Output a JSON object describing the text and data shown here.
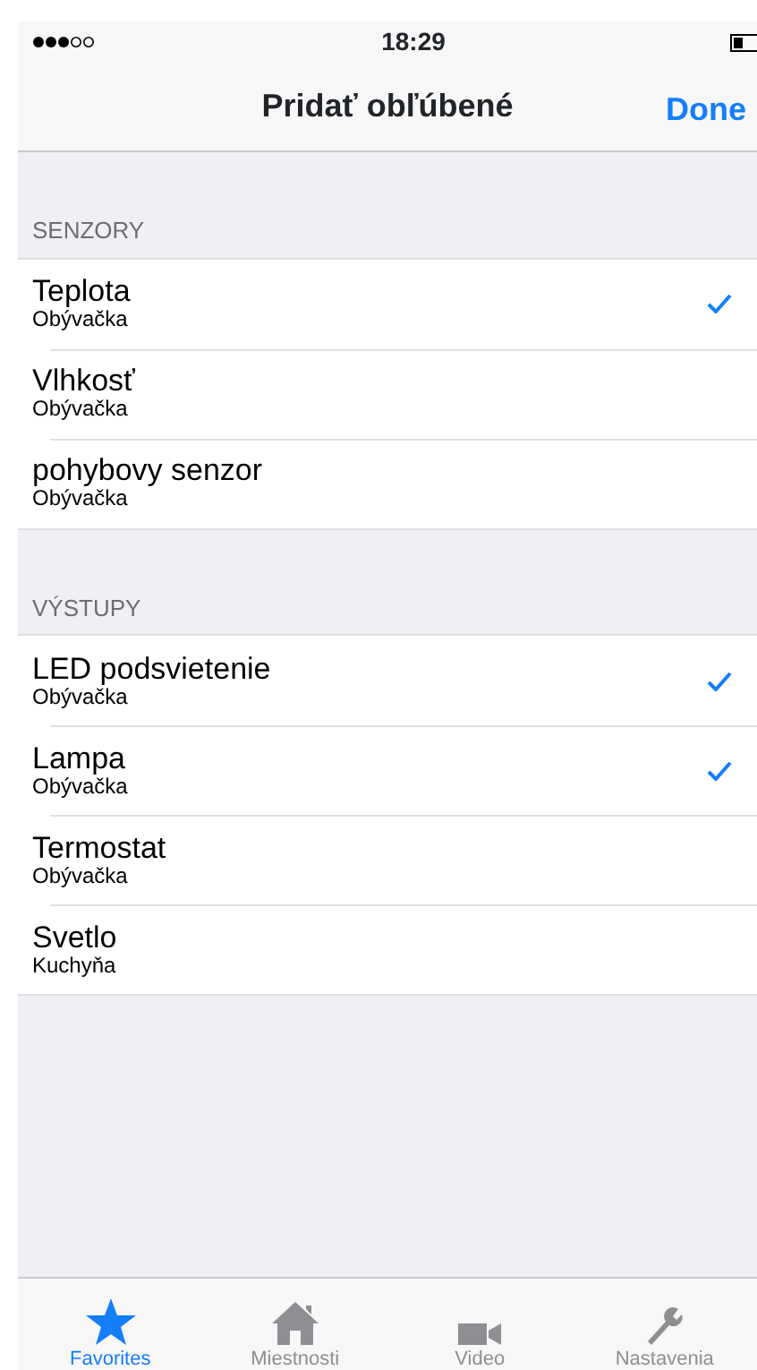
{
  "status_bar": {
    "time": "18:29"
  },
  "nav": {
    "title": "Pridať obľúbené",
    "done": "Done"
  },
  "sections": [
    {
      "header": "SENZORY",
      "items": [
        {
          "title": "Teplota",
          "subtitle": "Obývačka",
          "checked": true
        },
        {
          "title": "Vlhkosť",
          "subtitle": "Obývačka",
          "checked": false
        },
        {
          "title": "pohybovy senzor",
          "subtitle": "Obývačka",
          "checked": false
        }
      ]
    },
    {
      "header": "VÝSTUPY",
      "items": [
        {
          "title": "LED podsvietenie",
          "subtitle": "Obývačka",
          "checked": true
        },
        {
          "title": "Lampa",
          "subtitle": "Obývačka",
          "checked": true
        },
        {
          "title": "Termostat",
          "subtitle": "Obývačka",
          "checked": false
        },
        {
          "title": "Svetlo",
          "subtitle": "Kuchyňa",
          "checked": false
        }
      ]
    }
  ],
  "tabs": [
    {
      "label": "Favorites",
      "kind": "star",
      "selected": true
    },
    {
      "label": "Miestnosti",
      "kind": "house",
      "selected": false
    },
    {
      "label": "Video",
      "kind": "camera",
      "selected": false
    },
    {
      "label": "Nastavenia",
      "kind": "wrench",
      "selected": false
    }
  ]
}
